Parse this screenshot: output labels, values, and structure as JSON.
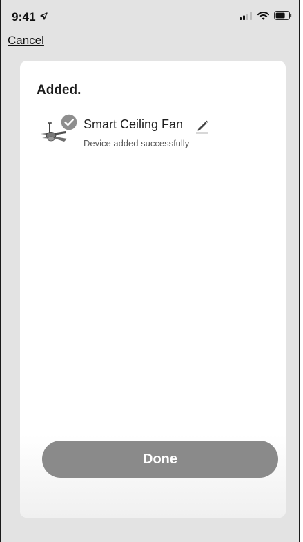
{
  "status_bar": {
    "time": "9:41",
    "location_icon": "location-arrow-icon",
    "signal_icon": "cellular-signal-icon",
    "wifi_icon": "wifi-icon",
    "battery_icon": "battery-icon"
  },
  "nav": {
    "cancel_label": "Cancel"
  },
  "card": {
    "title": "Added.",
    "device": {
      "name": "Smart Ceiling Fan",
      "status": "Device added successfully",
      "thumbnail_icon": "ceiling-fan-icon",
      "badge_icon": "check-circle-icon",
      "edit_icon": "pencil-icon"
    },
    "done_label": "Done"
  },
  "colors": {
    "background": "#e3e3e3",
    "card": "#ffffff",
    "button": "#8a8a8a",
    "check_badge": "#8e8e8e"
  }
}
